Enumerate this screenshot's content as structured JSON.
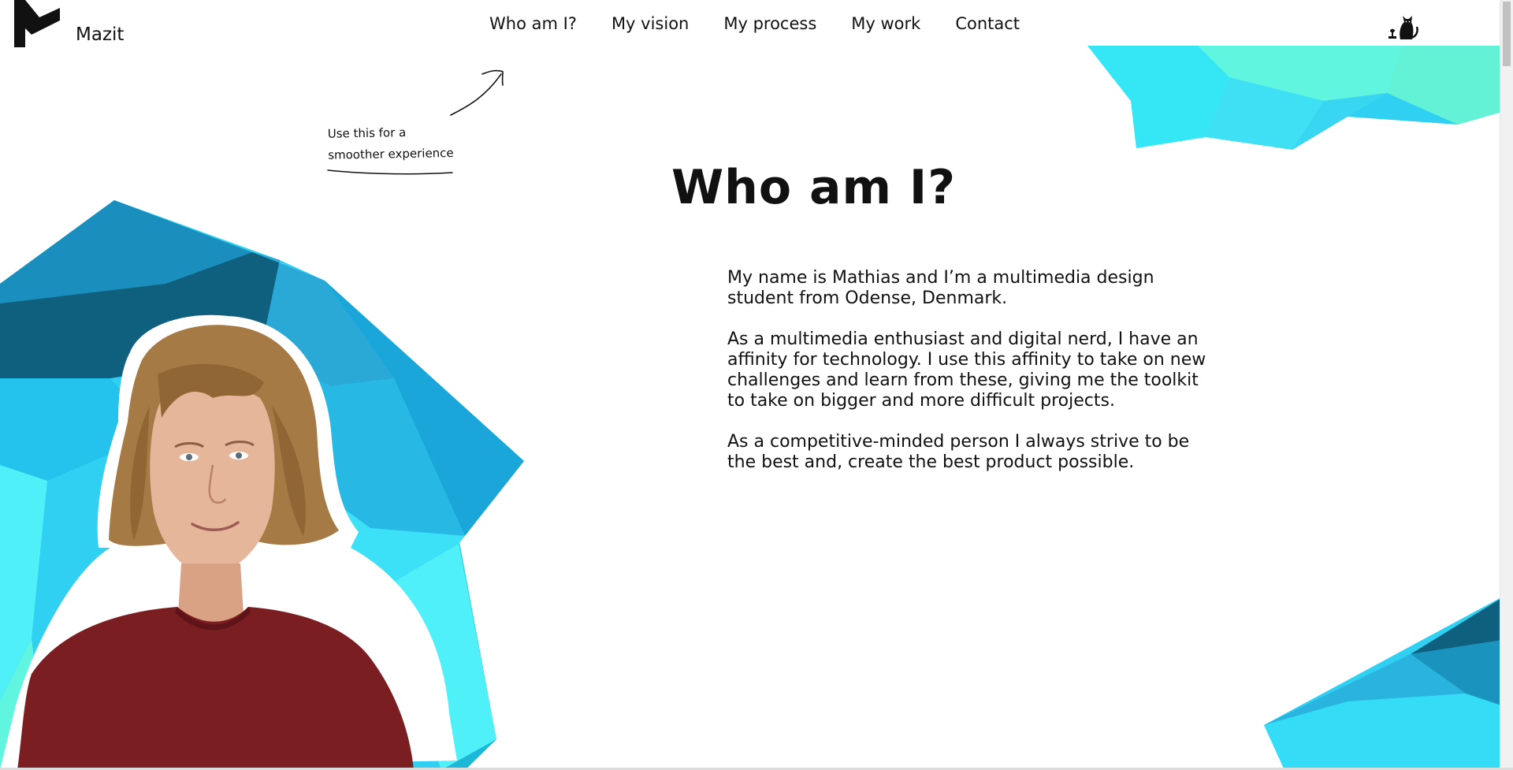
{
  "brand": {
    "name": "Mazit",
    "logo_icon": "mazit-m-logo-icon"
  },
  "nav": {
    "items": [
      {
        "label": "Who am I?"
      },
      {
        "label": "My vision"
      },
      {
        "label": "My process"
      },
      {
        "label": "My work"
      },
      {
        "label": "Contact"
      }
    ]
  },
  "theme_toggle": {
    "icon": "cat-lamp-icon"
  },
  "hint": {
    "line1": "Use this for a",
    "line2": "smoother experience",
    "arrow_icon": "hand-drawn-arrow-icon"
  },
  "main": {
    "title": "Who am I?",
    "paragraphs": [
      "My name is Mathias and I’m a multimedia design student from Odense, Denmark.",
      "As a multimedia enthusiast and digital nerd, I have an affinity for technology. I use this affinity to take on new challenges and learn from these, giving me the toolkit to take on bigger and more difficult projects.",
      "As a competitive-minded person I always strive to be the best and, create the best product possible."
    ]
  },
  "colors": {
    "deep_teal": "#0f5f7e",
    "teal": "#1a93bf",
    "blue": "#2bb3e0",
    "sky": "#2fd0f2",
    "cyan": "#4ff0f7",
    "aqua": "#5ff5df",
    "shirt": "#7a1e22",
    "hair": "#a57a45",
    "skin": "#e6b69a"
  }
}
